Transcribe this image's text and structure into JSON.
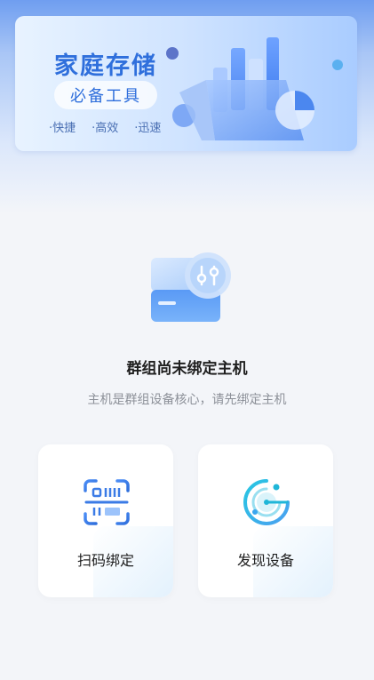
{
  "banner": {
    "title": "家庭存储",
    "pill": "必备工具",
    "features": [
      "·快捷",
      "·高效",
      "·迅速"
    ]
  },
  "empty_state": {
    "title": "群组尚未绑定主机",
    "subtitle": "主机是群组设备核心，请先绑定主机"
  },
  "actions": {
    "scan_bind": {
      "label": "扫码绑定",
      "icon": "qr-scan-icon"
    },
    "discover": {
      "label": "发现设备",
      "icon": "radar-icon"
    }
  },
  "colors": {
    "accent": "#2f6fdc",
    "cyan": "#35c6e6"
  }
}
